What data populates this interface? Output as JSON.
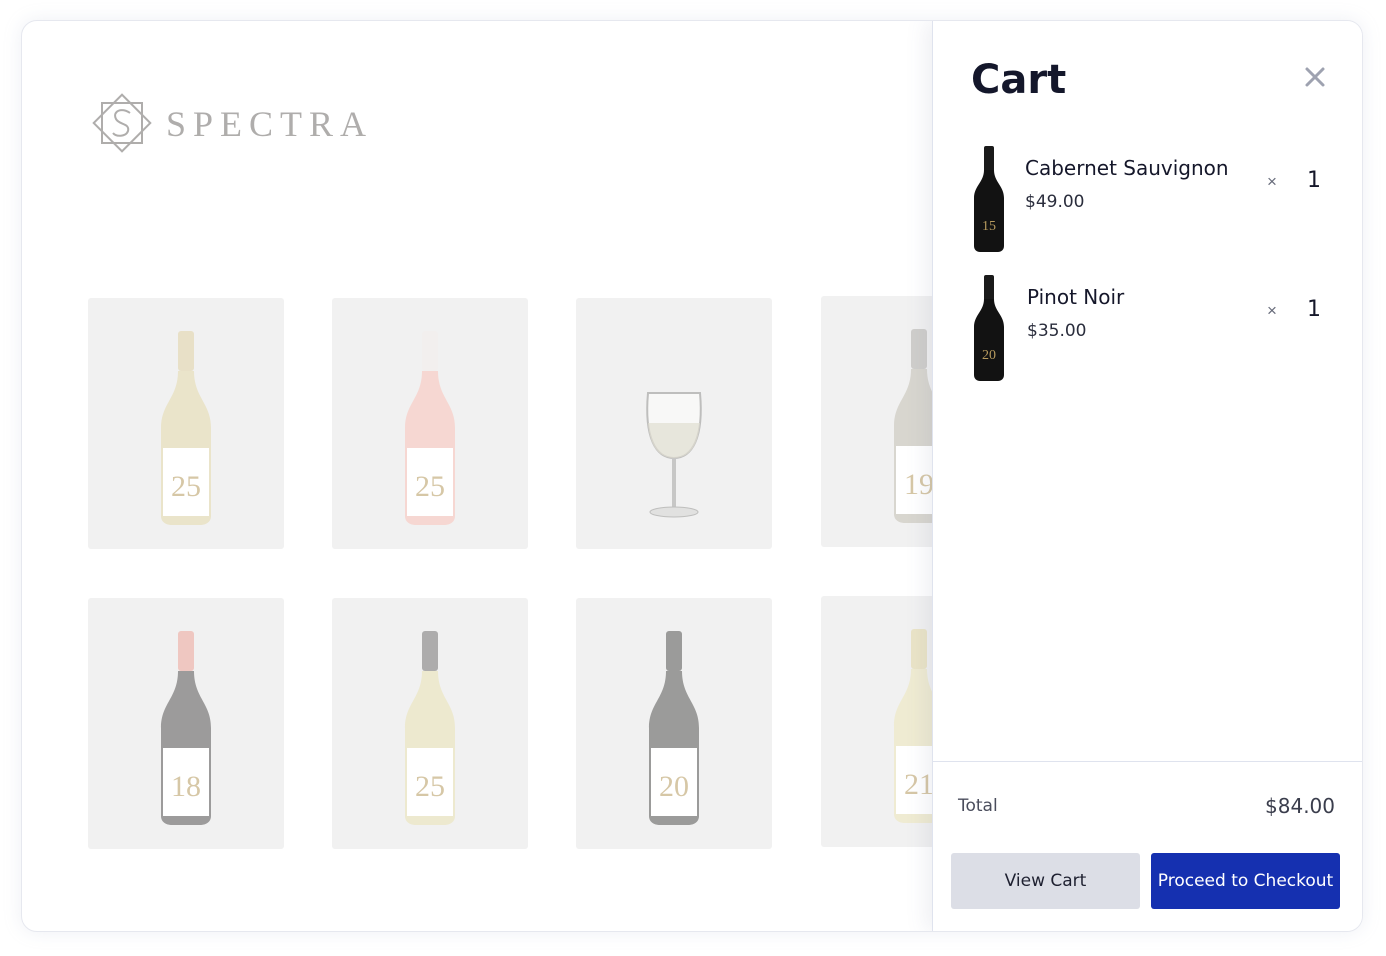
{
  "brand": {
    "name": "SPECTRA"
  },
  "catalog": {
    "tiles": [
      {
        "label_number": "25",
        "kind": "white-wine-bottle",
        "bottle_color": "#d9cfa0",
        "neck_color": "#d6c79a"
      },
      {
        "label_number": "25",
        "kind": "rose-wine-bottle",
        "bottle_color": "#f0b8ae",
        "neck_color": "#e8e3e1"
      },
      {
        "label_number": "",
        "kind": "wine-glass"
      },
      {
        "label_number": "19",
        "kind": "white-wine-bottle",
        "bottle_color": "#b9b5a9",
        "neck_color": "#a9a7a2"
      },
      {
        "label_number": "18",
        "kind": "red-wine-bottle",
        "bottle_color": "#4c4b4b",
        "neck_color": "#e29a8f"
      },
      {
        "label_number": "25",
        "kind": "white-wine-bottle",
        "bottle_color": "#dfd8a8",
        "neck_color": "#6b6a6a"
      },
      {
        "label_number": "20",
        "kind": "dark-wine-bottle",
        "bottle_color": "#4a4a48",
        "neck_color": "#4a4a48"
      },
      {
        "label_number": "21",
        "kind": "white-wine-bottle",
        "bottle_color": "#e2dcae",
        "neck_color": "#d9cf9a"
      }
    ]
  },
  "cart": {
    "title": "Cart",
    "close_icon": "close-icon",
    "items": [
      {
        "name": "Cabernet Sauvignon",
        "price": "$49.00",
        "remove_symbol": "×",
        "quantity": "1",
        "bottle_number": "15"
      },
      {
        "name": "Pinot Noir",
        "price": "$35.00",
        "remove_symbol": "×",
        "quantity": "1",
        "bottle_number": "20"
      }
    ],
    "total_label": "Total",
    "total_value": "$84.00",
    "view_cart_label": "View Cart",
    "checkout_label": "Proceed to Checkout",
    "colors": {
      "checkout_button": "#1530b0",
      "view_cart_button": "#dcdee6"
    }
  }
}
